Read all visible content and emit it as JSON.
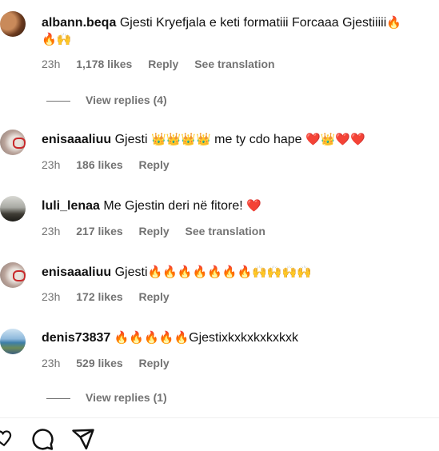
{
  "comments": [
    {
      "username": "albann.beqa",
      "text": "Gjesti Kryefjala e keti formatiii Forcaaa Gjestiiiii",
      "text_emojis_inline": "🔥",
      "text_line2": "🔥🙌",
      "time": "23h",
      "likes": "1,178 likes",
      "reply": "Reply",
      "translate": "See translation"
    },
    {
      "username": "enisaaaliuu",
      "text_prefix": "Gjesti",
      "text_emojis1": "👑👑👑👑",
      "text_middle": "me ty cdo hape",
      "text_emojis2": "❤️👑❤️❤️",
      "time": "23h",
      "likes": "186 likes",
      "reply": "Reply"
    },
    {
      "username": "luli_lenaa",
      "text": "Me Gjestin deri në fitore!",
      "text_emojis": "❤️",
      "time": "23h",
      "likes": "217 likes",
      "reply": "Reply",
      "translate": "See translation"
    },
    {
      "username": "enisaaaliuu",
      "text": "Gjesti",
      "text_emojis": "🔥🔥🔥🔥🔥🔥🔥🙌🙌🙌🙌",
      "time": "23h",
      "likes": "172 likes",
      "reply": "Reply"
    },
    {
      "username": "denis73837",
      "text_emojis": "🔥🔥🔥🔥🔥",
      "text": "Gjestixkxkxkxkxkxk",
      "time": "23h",
      "likes": "529 likes",
      "reply": "Reply"
    }
  ],
  "view_replies": [
    "View replies (4)",
    "View replies (1)"
  ],
  "icons": [
    "heart-icon",
    "comment-icon",
    "share-icon"
  ]
}
